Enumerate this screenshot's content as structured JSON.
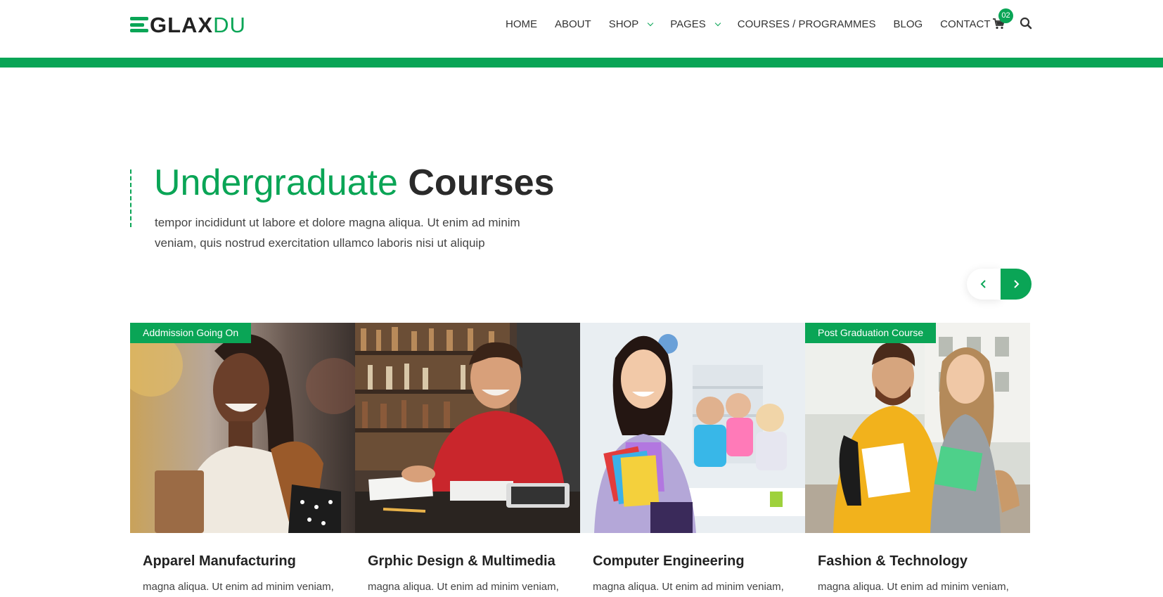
{
  "brand": {
    "logo_main": "GLAX",
    "logo_accent": "DU",
    "accent_color": "#0aa556"
  },
  "nav": {
    "items": [
      {
        "label": "HOME",
        "dropdown": false
      },
      {
        "label": "ABOUT",
        "dropdown": false
      },
      {
        "label": "SHOP",
        "dropdown": true
      },
      {
        "label": "PAGES",
        "dropdown": true
      },
      {
        "label": "COURSES / PROGRAMMES",
        "dropdown": false
      },
      {
        "label": "BLOG",
        "dropdown": false
      },
      {
        "label": "CONTACT",
        "dropdown": false
      }
    ],
    "cart_count": "02",
    "icons": [
      "cart-icon",
      "search-icon"
    ]
  },
  "hero": {
    "title_light": "Undergraduate",
    "title_bold": "Courses",
    "description": "tempor incididunt ut labore et dolore magna aliqua. Ut enim ad minim veniam, quis nostrud exercitation ullamco laboris nisi ut aliquip"
  },
  "slider": {
    "prev_icon": "chevron-left-icon",
    "next_icon": "chevron-right-icon"
  },
  "courses": [
    {
      "badge": "Addmission Going On",
      "title": "Apparel Manufacturing",
      "description": "magna aliqua. Ut enim ad minim veniam,"
    },
    {
      "badge": "",
      "title": "Grphic Design & Multimedia",
      "description": "magna aliqua. Ut enim ad minim veniam,"
    },
    {
      "badge": "",
      "title": "Computer Engineering",
      "description": "magna aliqua. Ut enim ad minim veniam,"
    },
    {
      "badge": "Post Graduation Course",
      "title": "Fashion & Technology",
      "description": "magna aliqua. Ut enim ad minim veniam,"
    }
  ]
}
